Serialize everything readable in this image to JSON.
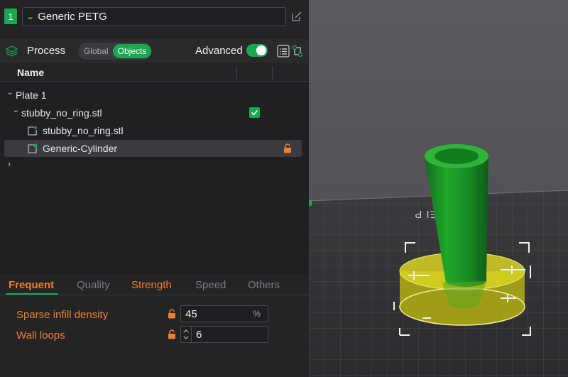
{
  "filament": {
    "index": "1",
    "name": "Generic PETG"
  },
  "process": {
    "title": "Process",
    "toggle_global": "Global",
    "toggle_objects": "Objects",
    "advanced_label": "Advanced",
    "advanced_on": true
  },
  "tree": {
    "header_name": "Name",
    "rows": [
      {
        "label": "Plate 1"
      },
      {
        "label": "stubby_no_ring.stl"
      },
      {
        "label": "stubby_no_ring.stl"
      },
      {
        "label": "Generic-Cylinder"
      }
    ]
  },
  "tabs": {
    "frequent": "Frequent",
    "quality": "Quality",
    "strength": "Strength",
    "speed": "Speed",
    "others": "Others"
  },
  "settings": {
    "sparse_infill_label": "Sparse infill density",
    "sparse_infill_value": "45",
    "sparse_infill_unit": "%",
    "wall_loops_label": "Wall loops",
    "wall_loops_value": "6"
  },
  "viewport": {
    "plate_label": "ate1 PEI P"
  },
  "colors": {
    "accent_green": "#1aa84f",
    "warning_orange": "#f27e2e",
    "model_green": "#1e9a2a",
    "modifier_yellow": "#c9c41a"
  }
}
